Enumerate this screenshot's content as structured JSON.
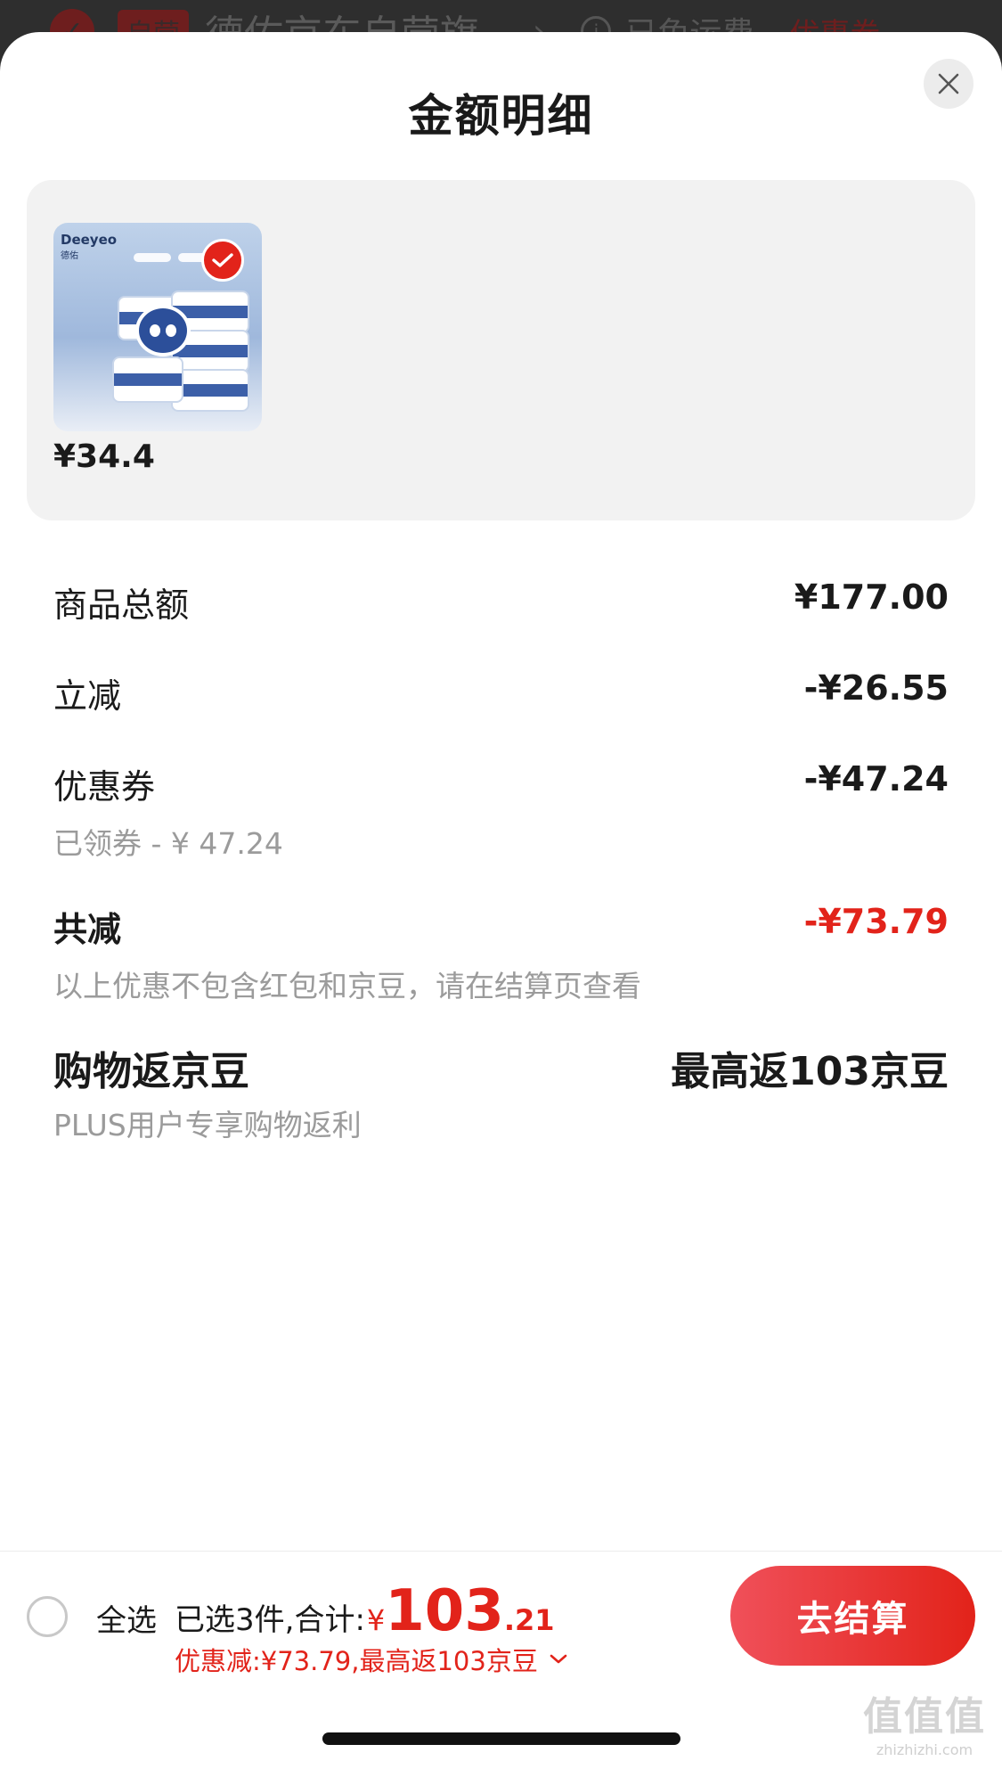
{
  "background_header": {
    "badge": "自营",
    "shop_name": "德佑京东自营旗",
    "shipping": "已免运费",
    "coupon": "优惠券"
  },
  "sheet": {
    "title": "金额明细",
    "close_icon": "close-icon"
  },
  "product": {
    "thumb_brand": "Deeyeo",
    "thumb_brand_sub": "德佑",
    "price": "¥34.4",
    "selected": true
  },
  "summary": {
    "goods_total_label": "商品总额",
    "goods_total_value": "¥177.00",
    "instant_discount_label": "立减",
    "instant_discount_value": "-¥26.55",
    "coupon_label": "优惠券",
    "coupon_value": "-¥47.24",
    "coupon_sub": "已领券 - ¥ 47.24",
    "total_discount_label": "共减",
    "total_discount_value": "-¥73.79",
    "total_discount_note": "以上优惠不包含红包和京豆，请在结算页查看",
    "beans_label": "购物返京豆",
    "beans_value": "最高返103京豆",
    "beans_sub": "PLUS用户专享购物返利"
  },
  "bottom_bar": {
    "select_all_label": "全选",
    "selected_text": "已选3件,合计:",
    "currency": "¥",
    "total_int": "103",
    "total_dec": ".21",
    "discount_line": "优惠减:¥73.79,最高返103京豆",
    "checkout_label": "去结算"
  },
  "watermark": {
    "logo": "值值值",
    "url": "zhizhizhi.com"
  },
  "colors": {
    "accent": "#e2231a",
    "card_bg": "#f2f2f2",
    "muted_text": "#9b9b9b"
  }
}
